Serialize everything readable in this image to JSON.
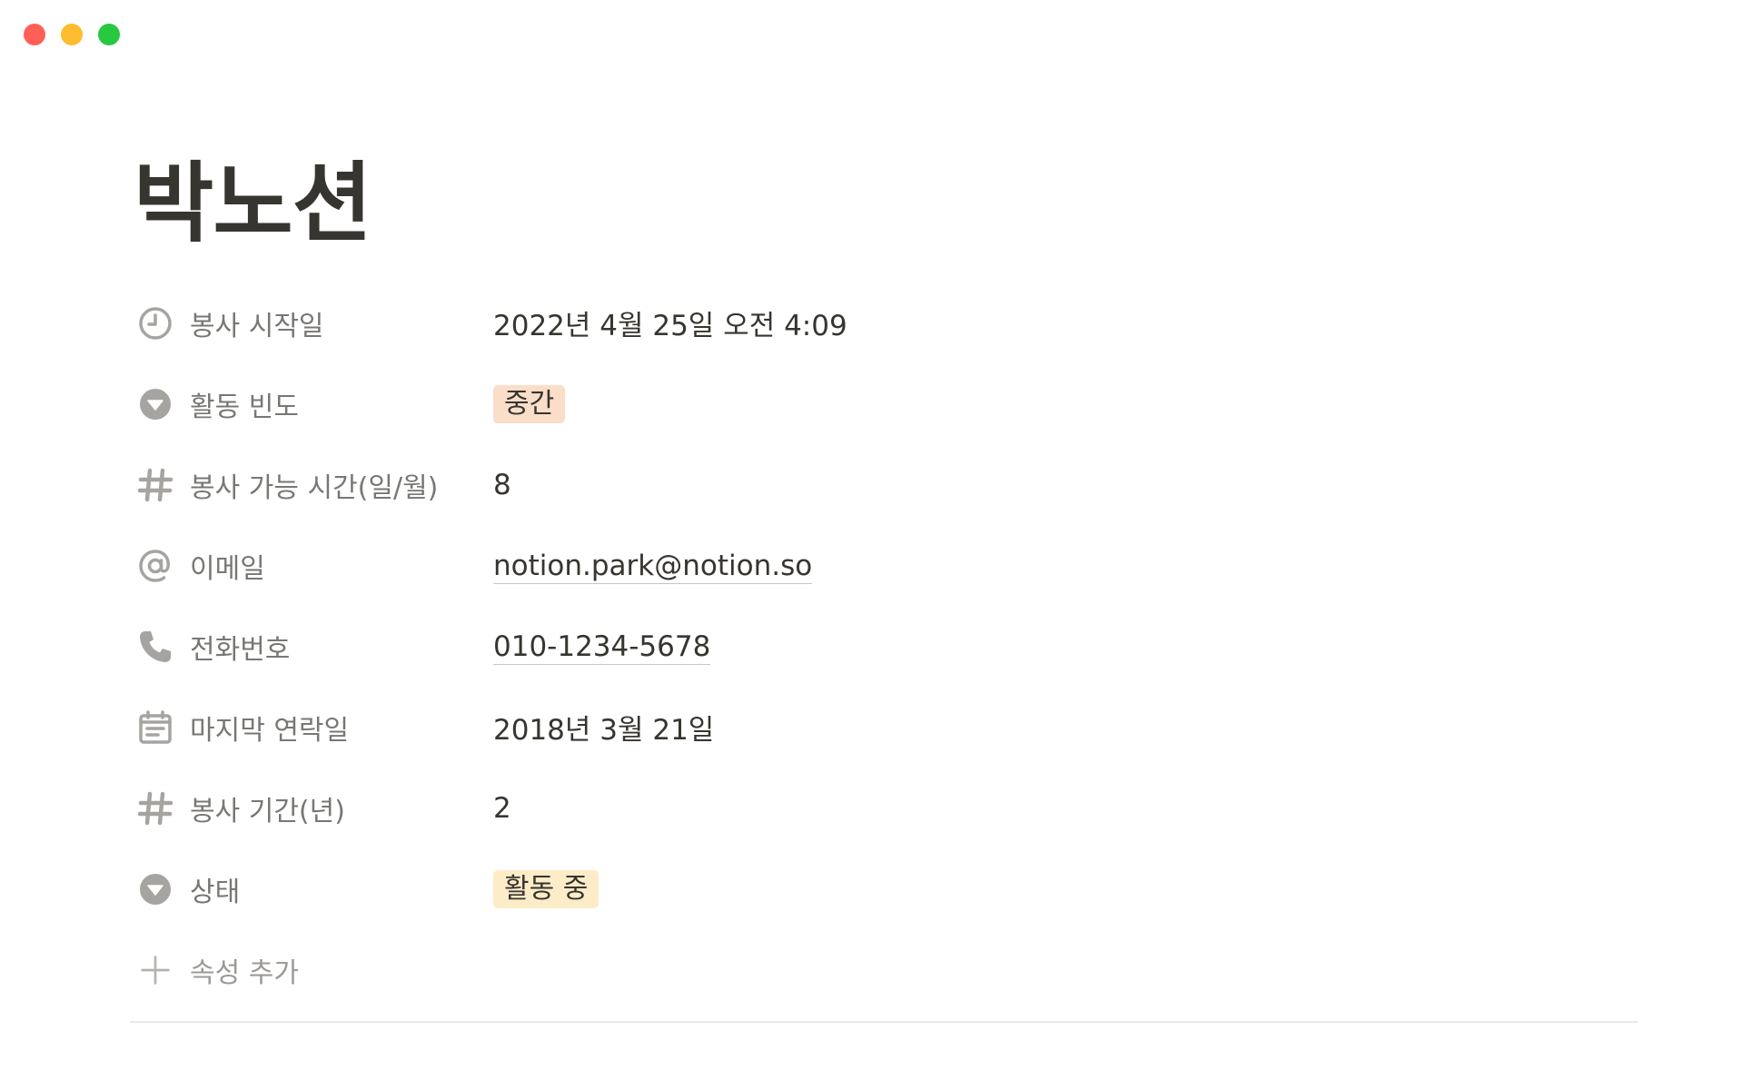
{
  "window": {
    "controls": {
      "close_color": "#ff5f57",
      "minimize_color": "#febc2e",
      "zoom_color": "#28c840"
    }
  },
  "page": {
    "title": "박노션"
  },
  "properties": [
    {
      "label": "봉사 시작일",
      "icon": "clock-icon",
      "value": "2022년 4월 25일 오전 4:09",
      "kind": "date"
    },
    {
      "label": "활동 빈도",
      "icon": "select-icon",
      "value": "중간",
      "kind": "tag",
      "tag_bg": "#fadec9",
      "tag_color": "#37352f"
    },
    {
      "label": "봉사 가능 시간(일/월)",
      "icon": "hash-icon",
      "value": "8",
      "kind": "number"
    },
    {
      "label": "이메일",
      "icon": "at-icon",
      "value": "notion.park@notion.so",
      "kind": "email"
    },
    {
      "label": "전화번호",
      "icon": "phone-icon",
      "value": "010-1234-5678",
      "kind": "phone"
    },
    {
      "label": "마지막 연락일",
      "icon": "calendar-icon",
      "value": "2018년 3월 21일",
      "kind": "date"
    },
    {
      "label": "봉사 기간(년)",
      "icon": "hash-icon",
      "value": "2",
      "kind": "number"
    },
    {
      "label": "상태",
      "icon": "select-icon",
      "value": "활동 중",
      "kind": "tag",
      "tag_bg": "#fdecc8",
      "tag_color": "#37352f"
    }
  ],
  "add_property": {
    "label": "속성 추가",
    "icon": "plus-icon"
  },
  "colors": {
    "text": "#37352f",
    "label": "#787774",
    "icon": "#a5a4a0",
    "divider": "#e9e9e7"
  }
}
